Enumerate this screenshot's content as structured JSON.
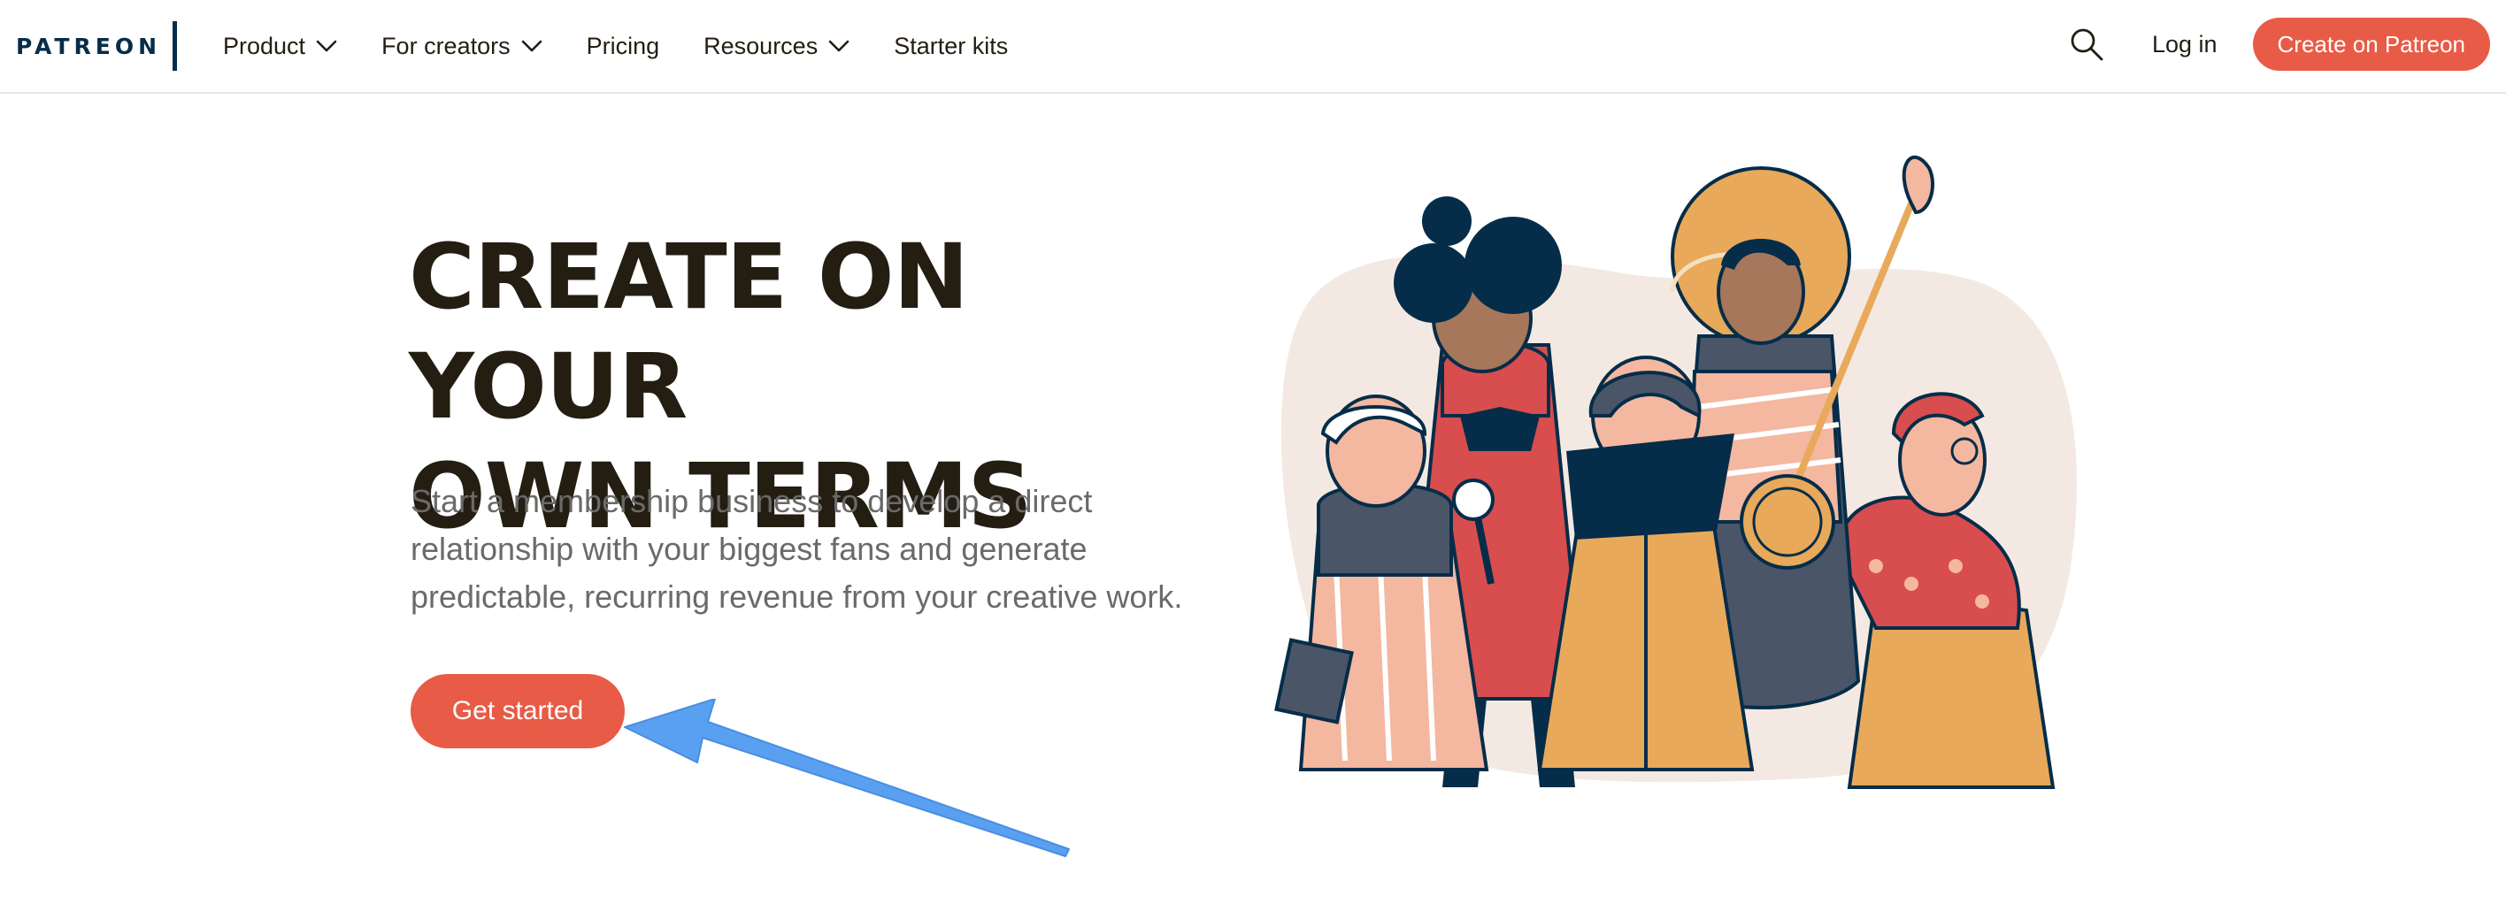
{
  "header": {
    "logo_text": "PATREON",
    "nav": [
      {
        "label": "Product",
        "has_dropdown": true
      },
      {
        "label": "For creators",
        "has_dropdown": true
      },
      {
        "label": "Pricing",
        "has_dropdown": false
      },
      {
        "label": "Resources",
        "has_dropdown": true
      },
      {
        "label": "Starter kits",
        "has_dropdown": false
      }
    ],
    "search_icon": "search-icon",
    "login_label": "Log in",
    "create_label": "Create on Patreon"
  },
  "hero": {
    "title_lines": [
      "CREATE ON YOUR",
      "OWN TERMS"
    ],
    "description_lines": [
      "Start a membership business to develop a direct",
      "relationship with your biggest fans and generate",
      "predictable, recurring revenue from your creative work."
    ],
    "cta_label": "Get started",
    "illustration": "creators-group-illustration",
    "annotation": "arrow-pointing-to-get-started"
  },
  "colors": {
    "brand_navy": "#052d49",
    "accent_coral": "#e85b46",
    "text_dark": "#241e12",
    "text_muted": "#6a6a6a",
    "annotation_arrow": "#5aa0f0"
  }
}
